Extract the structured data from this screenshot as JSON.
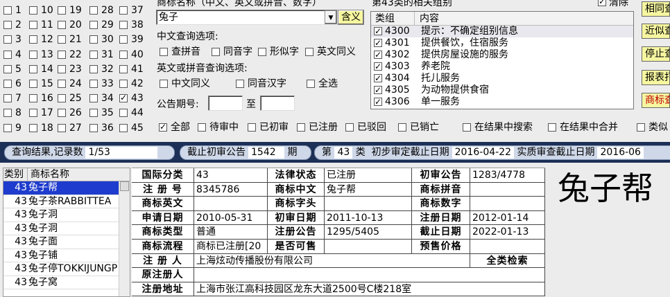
{
  "class_grid": {
    "col1": [
      "1",
      "2",
      "3",
      "4",
      "5",
      "6",
      "7",
      "8",
      "9"
    ],
    "col2": [
      "10",
      "11",
      "12",
      "13",
      "14",
      "15",
      "16",
      "17",
      "18"
    ],
    "col3": [
      "19",
      "20",
      "21",
      "22",
      "23",
      "24",
      "25",
      "26",
      "27"
    ],
    "col4": [
      "28",
      "29",
      "30",
      "31",
      "32",
      "33",
      "34",
      "35",
      "36"
    ],
    "col5": [
      "37",
      "38",
      "39",
      "40",
      "41",
      "42",
      "43",
      "44",
      "45"
    ]
  },
  "search": {
    "name_label": "商标名称（中文、英文或拼音、数字）",
    "value": "兔子",
    "dropdown_arrow": "▼",
    "synonym_button": "含义",
    "cn_options_label": "中文查询选项:",
    "cn_options": [
      "查拼音",
      "同音字",
      "形似字",
      "英文同义"
    ],
    "en_options_label": "英文或拼音查询选项:",
    "en_options": [
      "中文同义",
      "同音汉字",
      "全选"
    ],
    "period_label": "公告期号:",
    "period_to": "至"
  },
  "related": {
    "title": "第43类的相关组别",
    "clear_label": "清除",
    "headers": [
      "类组",
      "内容"
    ],
    "rows": [
      {
        "code": "4300",
        "text": "提示：不确定组别信息"
      },
      {
        "code": "4301",
        "text": "提供餐饮，住宿服务"
      },
      {
        "code": "4302",
        "text": "提供房屋设施的服务"
      },
      {
        "code": "4303",
        "text": "养老院"
      },
      {
        "code": "4304",
        "text": "托儿服务"
      },
      {
        "code": "4305",
        "text": "为动物提供食宿"
      },
      {
        "code": "4306",
        "text": "单一服务"
      }
    ]
  },
  "right_buttons": [
    "相同查",
    "近似查",
    "停止查",
    "报表打",
    "商标查"
  ],
  "status_filters": [
    "全部",
    "待审中",
    "已初审",
    "已注册",
    "已驳回",
    "已销亡"
  ],
  "result_options": [
    "在结果中搜索",
    "在结果中合并",
    "类似"
  ],
  "bar": {
    "result_label": "查询结果,记录数",
    "result_value": "1/53",
    "deadline_label": "截止初审公告",
    "deadline_value": "1542",
    "deadline_unit": "期",
    "class_prefix": "第",
    "class_no": "43",
    "class_suffix": "类",
    "prelim_label": "初步审定截止日期",
    "prelim_date": "2016-04-22",
    "exam_label": "实质审查截止日期",
    "exam_date": "2016-06"
  },
  "list": {
    "headers": [
      "类别",
      "商标名称"
    ],
    "rows": [
      {
        "cls": "43",
        "name": "兔子帮"
      },
      {
        "cls": "43",
        "name": "兔子茶RABBITTEA"
      },
      {
        "cls": "43",
        "name": "兔子洞"
      },
      {
        "cls": "43",
        "name": "兔子洞"
      },
      {
        "cls": "43",
        "name": "兔子面"
      },
      {
        "cls": "43",
        "name": "兔子铺"
      },
      {
        "cls": "43",
        "name": "兔子停TOKKIJUNGP"
      },
      {
        "cls": "43",
        "name": "兔子窝"
      }
    ]
  },
  "detail": {
    "intl_class_label": "国际分类",
    "intl_class": "43",
    "legal_status_label": "法律状态",
    "legal_status": "已注册",
    "prelim_pub_label": "初审公告",
    "prelim_pub": "1283/4778",
    "reg_no_label": "注 册 号",
    "reg_no": "8345786",
    "cn_name_label": "商标中文",
    "cn_name": "兔子帮",
    "pinyin_label": "商标拼音",
    "pinyin": "",
    "en_name_label": "商标英文",
    "en_name": "",
    "initial_label": "商标字头",
    "initial": "",
    "digit_label": "商标数字",
    "digit": "",
    "apply_date_label": "申请日期",
    "apply_date": "2010-05-31",
    "prelim_date_label": "初审日期",
    "prelim_date": "2011-10-13",
    "reg_date_label": "注册日期",
    "reg_date": "2012-01-14",
    "type_label": "商标类型",
    "type": "普通",
    "reg_pub_label": "注册公告",
    "reg_pub": "1295/5405",
    "expiry_label": "截止日期",
    "expiry": "2022-01-13",
    "flow_label": "商标流程",
    "flow": "商标已注册[20",
    "sellable_label": "是否可售",
    "sellable": "",
    "presale_label": "预售价格",
    "presale": "",
    "registrant_label": "注 册 人",
    "registrant": "上海炫动传播股份有限公司",
    "all_class_search": "全类检索",
    "orig_registrant_label": "原注册人",
    "orig_registrant": "",
    "address_label": "注册地址",
    "address": "上海市张江高科技园区龙东大道2500号C楼218室"
  },
  "preview_name": "兔子帮"
}
